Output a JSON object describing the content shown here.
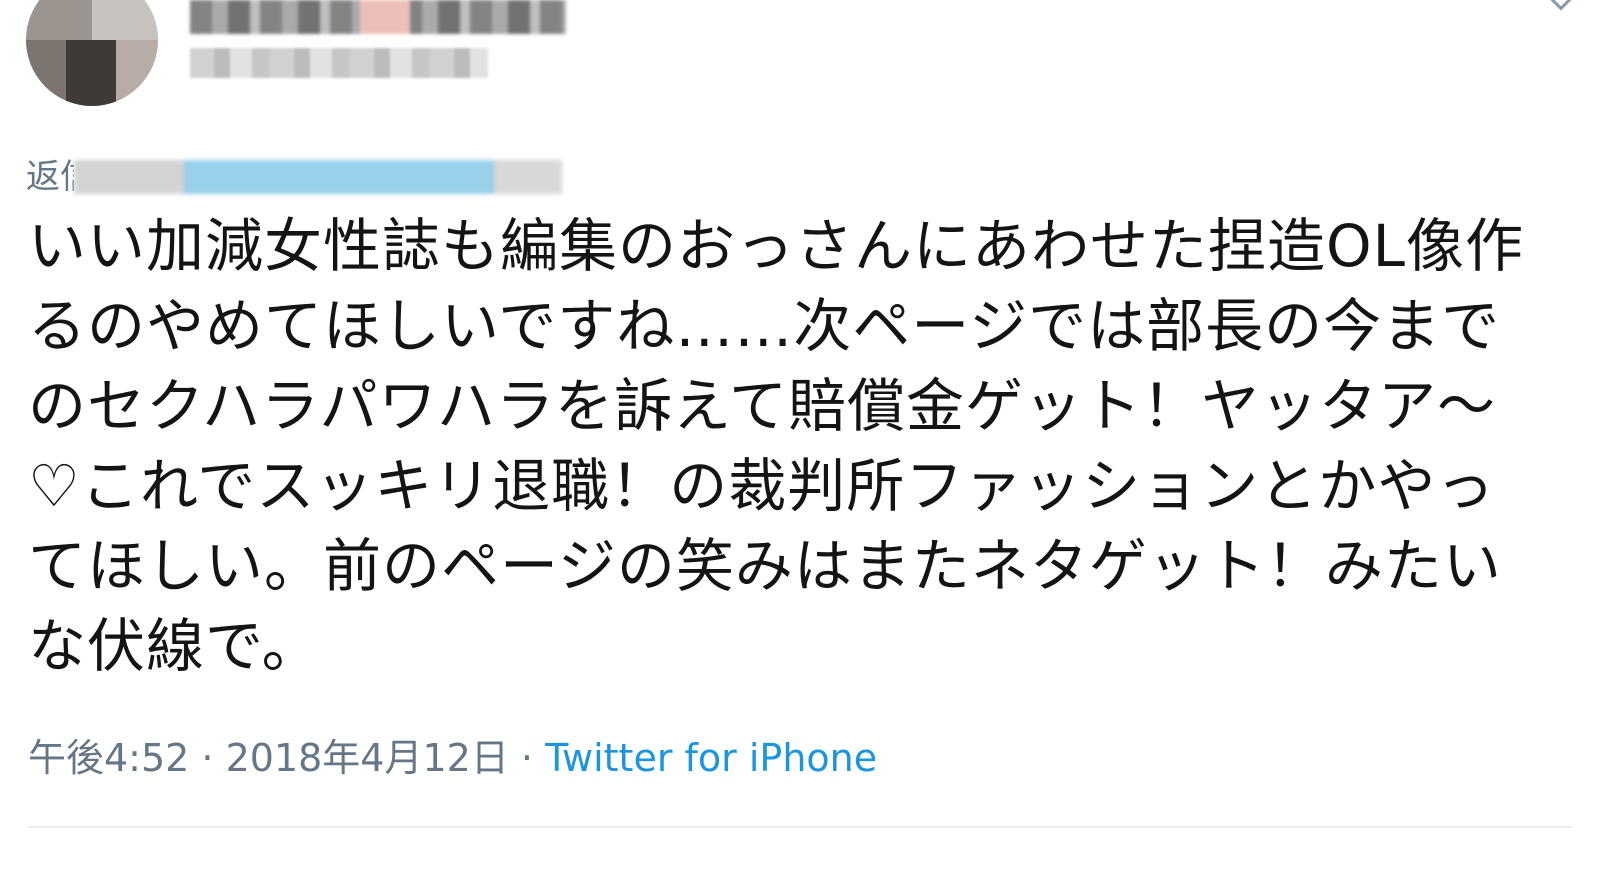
{
  "tweet": {
    "author_name": "",
    "author_handle": "",
    "reply_prefix": "返信先:",
    "text": "いい加減女性誌も編集のおっさんにあわせた捏造OL像作るのやめてほしいですね……次ページでは部長の今までのセクハラパワハラを訴えて賠償金ゲット！ヤッタア〜♡これでスッキリ退職！の裁判所ファッションとかやってほしい。前のページの笑みはまたネタゲット！みたいな伏線で。",
    "time": "午後4:52",
    "separator": " · ",
    "date": "2018年4月12日",
    "source": "Twitter for iPhone"
  },
  "icons": {
    "more": "chevron-down-icon"
  },
  "colors": {
    "text": "#141414",
    "muted": "#657786",
    "link": "#1b95e0",
    "divider": "#e6ecf0"
  }
}
